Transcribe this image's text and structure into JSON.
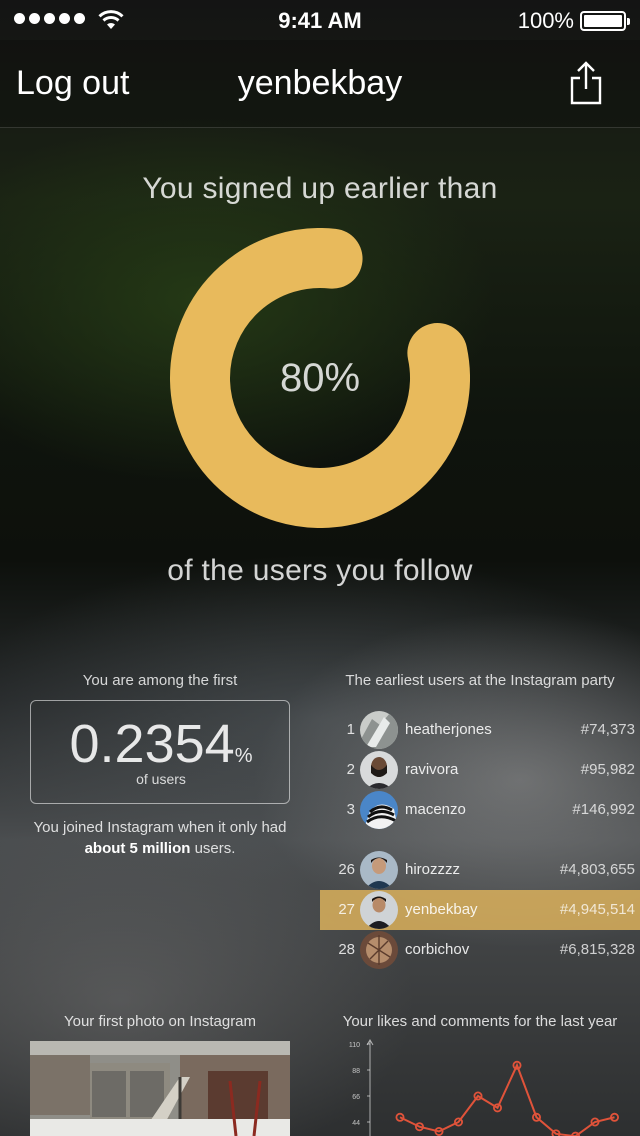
{
  "status_bar": {
    "time": "9:41 AM",
    "battery": "100%"
  },
  "nav": {
    "left_button": "Log out",
    "title": "yenbekbay",
    "share_icon": "share-icon"
  },
  "hero": {
    "top_text": "You signed up earlier than",
    "percent_value": "80%",
    "percent_fraction": 0.8,
    "ring_color": "#e8ba5c",
    "bottom_text": "of the users you follow"
  },
  "among": {
    "title": "You are among the first",
    "value": "0.2354",
    "percent_sign": "%",
    "unit": "of users",
    "joined_prefix": "You joined Instagram when it only had ",
    "joined_bold": "about 5 million",
    "joined_suffix": " users."
  },
  "ranking": {
    "title": "The earliest users at the Instagram party",
    "highlight_color": "#dab05c",
    "top": [
      {
        "rank": "1",
        "name": "heatherjones",
        "id": "#74,373"
      },
      {
        "rank": "2",
        "name": "ravivora",
        "id": "#95,982"
      },
      {
        "rank": "3",
        "name": "macenzo",
        "id": "#146,992"
      }
    ],
    "nearby": [
      {
        "rank": "26",
        "name": "hirozzzz",
        "id": "#4,803,655"
      },
      {
        "rank": "27",
        "name": "yenbekbay",
        "id": "#4,945,514"
      },
      {
        "rank": "28",
        "name": "corbichov",
        "id": "#6,815,328"
      }
    ]
  },
  "first_photo": {
    "title": "Your first photo on Instagram"
  },
  "likes_chart": {
    "title": "Your likes and comments for the last year",
    "chart_data": {
      "type": "line",
      "y_ticks": [
        "110",
        "88",
        "66",
        "44"
      ],
      "ylim": [
        22,
        110
      ],
      "values": [
        48,
        40,
        36,
        44,
        66,
        56,
        92,
        48,
        34,
        32,
        44,
        48
      ],
      "line_color": "#e0533a"
    }
  }
}
